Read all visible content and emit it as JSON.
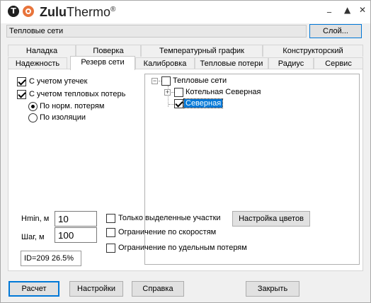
{
  "app": {
    "name_bold": "Zulu",
    "name_rest": "Thermo",
    "reg": "®"
  },
  "window_controls": {
    "minimize": "_",
    "maximize": "▲",
    "close": "✕"
  },
  "layer": {
    "value": "Тепловые сети",
    "button": "Слой..."
  },
  "tabs_back": [
    "Наладка",
    "Поверка",
    "Температурный график",
    "Конструкторский"
  ],
  "tabs_front": [
    "Надежность",
    "Резерв сети",
    "Калибровка",
    "Тепловые потери",
    "Радиус",
    "Сервис"
  ],
  "active_tab": "Резерв сети",
  "options": {
    "leaks": "С учетом утечек",
    "heat_losses": "С учетом тепловых потерь",
    "by_norm": "По норм. потерям",
    "by_insulation": "По изоляции"
  },
  "tree": {
    "root": "Тепловые сети",
    "child1": "Котельная Северная",
    "child2": "Северная"
  },
  "params": {
    "hmin_label": "Hmin, м",
    "hmin_value": "10",
    "step_label": "Шаг, м",
    "step_value": "100",
    "status": "ID=209 26.5%"
  },
  "filters": {
    "selected_only": "Только выделенные участки",
    "color_button": "Настройка цветов",
    "by_speed": "Ограничение по скоростям",
    "by_specific_loss": "Ограничение по удельным потерям"
  },
  "buttons": {
    "calc": "Расчет",
    "settings": "Настройки",
    "help": "Справка",
    "close": "Закрыть"
  },
  "colors": {
    "accent": "#0078d7",
    "logo_orange": "#e8743b"
  }
}
